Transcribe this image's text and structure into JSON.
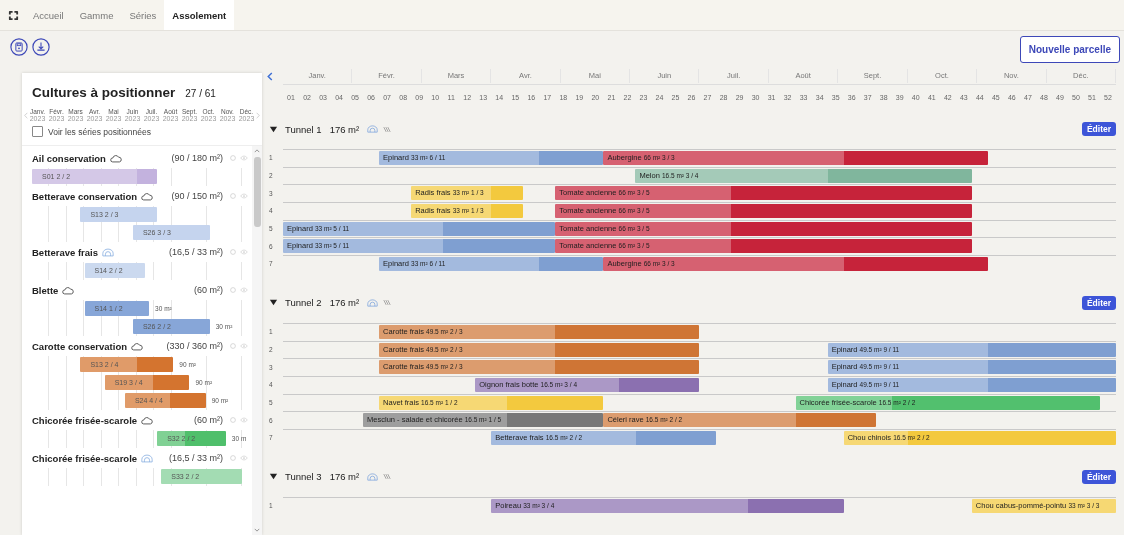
{
  "nav": {
    "tabs": [
      {
        "label": "Accueil",
        "selected": false
      },
      {
        "label": "Gamme",
        "selected": false
      },
      {
        "label": "Séries",
        "selected": false
      },
      {
        "label": "Assolement",
        "selected": true
      }
    ]
  },
  "toolbar": {
    "new_button": "Nouvelle parcelle"
  },
  "panel": {
    "title": "Cultures à positionner",
    "count": "27 / 61",
    "months": [
      {
        "label": "Janv.",
        "year": "2023"
      },
      {
        "label": "Févr.",
        "year": "2023"
      },
      {
        "label": "Mars",
        "year": "2023"
      },
      {
        "label": "Avr.",
        "year": "2023"
      },
      {
        "label": "Mai",
        "year": "2023"
      },
      {
        "label": "Juin",
        "year": "2023"
      },
      {
        "label": "Juil.",
        "year": "2023"
      },
      {
        "label": "Août",
        "year": "2023"
      },
      {
        "label": "Sept.",
        "year": "2023"
      },
      {
        "label": "Oct.",
        "year": "2023"
      },
      {
        "label": "Nov.",
        "year": "2023"
      },
      {
        "label": "Déc.",
        "year": "2023"
      }
    ],
    "show_positioned": {
      "label": "Voir les séries positionnées",
      "checked": false
    },
    "crops": [
      {
        "name": "Ail conservation",
        "kind": "field",
        "area": "(90 / 180 m²)",
        "series": [
          {
            "label": "S01 2 / 2",
            "color": "#c3b2de"
          }
        ]
      },
      {
        "name": "Betterave conservation",
        "kind": "field",
        "area": "(90 / 150 m²)",
        "series": [
          {
            "label": "S13 2 / 3",
            "color": "#c5d4ee"
          },
          {
            "label": "S26 3 / 3",
            "color": "#c5d4ee"
          }
        ]
      },
      {
        "name": "Betterave frais",
        "kind": "tunnel",
        "area": "(16,5 / 33 m²)",
        "series": [
          {
            "label": "S14 2 / 2",
            "color": "#cbd9ef"
          }
        ]
      },
      {
        "name": "Blette",
        "kind": "field",
        "area": "(60 m²)",
        "series": [
          {
            "label": "S14 1 / 2",
            "color": "#87a6d8",
            "area": "30 m²"
          },
          {
            "label": "S26 2 / 2",
            "color": "#87a6d8",
            "area": "30 m²"
          }
        ]
      },
      {
        "name": "Carotte conservation",
        "kind": "field",
        "area": "(330 / 360 m²)",
        "series": [
          {
            "label": "S13 2 / 4",
            "color": "#d4742f",
            "area": "90 m²"
          },
          {
            "label": "S19 3 / 4",
            "color": "#d4742f",
            "area": "90 m²"
          },
          {
            "label": "S24 4 / 4",
            "color": "#d4742f",
            "area": "90 m²"
          }
        ]
      },
      {
        "name": "Chicorée frisée-scarole",
        "kind": "field",
        "area": "(60 m²)",
        "series": [
          {
            "label": "S32 2 / 2",
            "color": "#4fbf6b",
            "area": "30 m"
          }
        ]
      },
      {
        "name": "Chicorée frisée-scarole",
        "kind": "tunnel",
        "area": "(16,5 / 33 m²)",
        "series": [
          {
            "label": "S33 2 / 2",
            "color": "#a3dcb3"
          }
        ]
      }
    ]
  },
  "timeline": {
    "months": [
      "Janv.",
      "Févr.",
      "Mars",
      "Avr.",
      "Mai",
      "Juin",
      "Juil.",
      "Août",
      "Sept.",
      "Oct.",
      "Nov.",
      "Déc."
    ],
    "weeks": [
      "01",
      "02",
      "03",
      "04",
      "05",
      "06",
      "07",
      "08",
      "09",
      "10",
      "11",
      "12",
      "13",
      "14",
      "15",
      "16",
      "17",
      "18",
      "19",
      "20",
      "21",
      "22",
      "23",
      "24",
      "25",
      "26",
      "27",
      "28",
      "29",
      "30",
      "31",
      "32",
      "33",
      "34",
      "35",
      "36",
      "37",
      "38",
      "39",
      "40",
      "41",
      "42",
      "43",
      "44",
      "45",
      "46",
      "47",
      "48",
      "49",
      "50",
      "51",
      "52"
    ],
    "plots": [
      {
        "name": "Tunnel 1",
        "area": "176 m²",
        "expanded": true,
        "edit": "Éditer",
        "rows": [
          {
            "number": "1",
            "crops": [
              {
                "name": "Epinard",
                "area": "33 m²",
                "series": "6 / 11",
                "color": "#7f9fd1"
              },
              {
                "name": "Aubergine",
                "area": "66 m²",
                "series": "3 / 3",
                "color": "#c6233a"
              }
            ]
          },
          {
            "number": "2",
            "crops": [
              {
                "name": "Melon",
                "area": "16.5 m²",
                "series": "3 / 4",
                "color": "#80b69d"
              }
            ]
          },
          {
            "number": "3",
            "crops": [
              {
                "name": "Radis frais",
                "area": "33 m²",
                "series": "1 / 3",
                "color": "#f3c93e"
              },
              {
                "name": "Tomate ancienne",
                "area": "66 m²",
                "series": "3 / 5",
                "color": "#c6233a"
              }
            ]
          },
          {
            "number": "4",
            "crops": [
              {
                "name": "Radis frais",
                "area": "33 m²",
                "series": "1 / 3",
                "color": "#f3c93e"
              },
              {
                "name": "Tomate ancienne",
                "area": "66 m²",
                "series": "3 / 5",
                "color": "#c6233a"
              }
            ]
          },
          {
            "number": "5",
            "crops": [
              {
                "name": "Epinard",
                "area": "33 m²",
                "series": "5 / 11",
                "color": "#7f9fd1"
              },
              {
                "name": "Tomate ancienne",
                "area": "66 m²",
                "series": "3 / 5",
                "color": "#c6233a"
              }
            ]
          },
          {
            "number": "6",
            "crops": [
              {
                "name": "Epinard",
                "area": "33 m²",
                "series": "5 / 11",
                "color": "#7f9fd1"
              },
              {
                "name": "Tomate ancienne",
                "area": "66 m²",
                "series": "3 / 5",
                "color": "#c6233a"
              }
            ]
          },
          {
            "number": "7",
            "crops": [
              {
                "name": "Epinard",
                "area": "33 m²",
                "series": "6 / 11",
                "color": "#7f9fd1"
              },
              {
                "name": "Aubergine",
                "area": "66 m²",
                "series": "3 / 3",
                "color": "#c6233a"
              }
            ]
          }
        ]
      },
      {
        "name": "Tunnel 2",
        "area": "176 m²",
        "expanded": true,
        "edit": "Éditer",
        "rows": [
          {
            "number": "1",
            "crops": [
              {
                "name": "Carotte frais",
                "area": "49.5 m²",
                "series": "2 / 3",
                "color": "#cf7535"
              }
            ]
          },
          {
            "number": "2",
            "crops": [
              {
                "name": "Carotte frais",
                "area": "49.5 m²",
                "series": "2 / 3",
                "color": "#cf7535"
              },
              {
                "name": "Epinard",
                "area": "49.5 m²",
                "series": "9 / 11",
                "color": "#7f9fd1"
              }
            ]
          },
          {
            "number": "3",
            "crops": [
              {
                "name": "Carotte frais",
                "area": "49.5 m²",
                "series": "2 / 3",
                "color": "#cf7535"
              },
              {
                "name": "Epinard",
                "area": "49.5 m²",
                "series": "9 / 11",
                "color": "#7f9fd1"
              }
            ]
          },
          {
            "number": "4",
            "crops": [
              {
                "name": "Oignon frais botte",
                "area": "16.5 m²",
                "series": "3 / 4",
                "color": "#8b70b0"
              },
              {
                "name": "Epinard",
                "area": "49.5 m²",
                "series": "9 / 11",
                "color": "#7f9fd1"
              }
            ]
          },
          {
            "number": "5",
            "crops": [
              {
                "name": "Navet frais",
                "area": "16.5 m²",
                "series": "1 / 2",
                "color": "#f3c93e"
              },
              {
                "name": "Chicorée frisée-scarole",
                "area": "16.5 m²",
                "series": "2 / 2",
                "color": "#52c06e"
              }
            ]
          },
          {
            "number": "6",
            "crops": [
              {
                "name": "Mesclun - salade et chicorée",
                "area": "16.5 m²",
                "series": "1 / 5",
                "color": "#787878"
              },
              {
                "name": "Céleri rave",
                "area": "16.5 m²",
                "series": "2 / 2",
                "color": "#cf7535"
              }
            ]
          },
          {
            "number": "7",
            "crops": [
              {
                "name": "Betterave frais",
                "area": "16.5 m²",
                "series": "2 / 2",
                "color": "#7f9fd1"
              },
              {
                "name": "Chou chinois",
                "area": "16.5 m²",
                "series": "2 / 2",
                "color": "#f3c93e"
              }
            ]
          }
        ]
      },
      {
        "name": "Tunnel 3",
        "area": "176 m²",
        "expanded": true,
        "edit": "Éditer",
        "rows": [
          {
            "number": "1",
            "crops": [
              {
                "name": "Poireau",
                "area": "33 m²",
                "series": "3 / 4",
                "color": "#8b70b0"
              },
              {
                "name": "Chou cabus-pommé-pointu",
                "area": "33 m²",
                "series": "3 / 3",
                "color": "#f6d873"
              }
            ]
          }
        ]
      }
    ]
  }
}
